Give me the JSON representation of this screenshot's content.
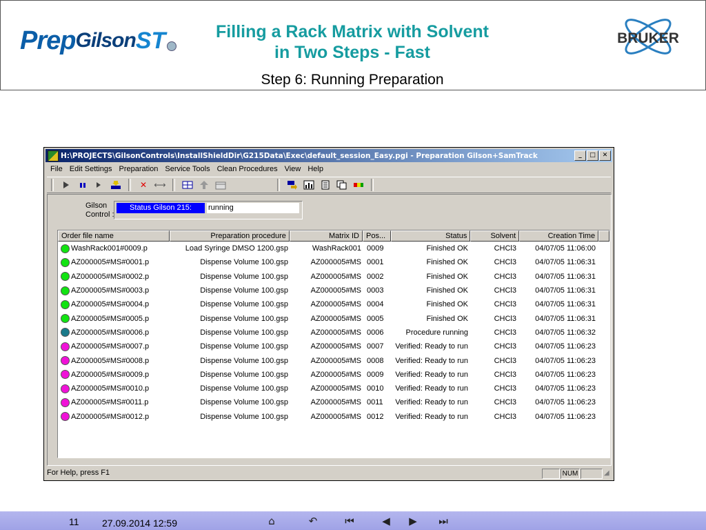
{
  "slide": {
    "logo_text": {
      "prep": "Prep",
      "gilson": "Gilson",
      "st": "ST"
    },
    "title_line1": "Filling a Rack Matrix with Solvent",
    "title_line2": "in Two Steps - Fast",
    "subtitle": "Step 6: Running Preparation",
    "brand": "BRUKER",
    "page_number": "11",
    "datetime": "27.09.2014 12:59"
  },
  "window": {
    "title": "H:\\PROJECTS\\GilsonControls\\InstallShieldDir\\G215Data\\Exec\\default_session_Easy.pgi - Preparation Gilson+SamTrack",
    "menu": [
      "File",
      "Edit Settings",
      "Preparation",
      "Service Tools",
      "Clean Procedures",
      "View",
      "Help"
    ],
    "gilson_control_label_line1": "Gilson",
    "gilson_control_label_line2": "Control :",
    "status_label": "Status Gilson 215:",
    "status_value": "running",
    "status_help": "For Help, press F1",
    "status_num": "NUM"
  },
  "table": {
    "columns": [
      "Order file name",
      "Preparation procedure",
      "Matrix ID",
      "Pos...",
      "Status",
      "Solvent",
      "Creation Time"
    ],
    "rows": [
      {
        "state": "ok",
        "file": "WashRack001#0009.p",
        "procedure": "Load Syringe DMSO 1200.gsp",
        "matrix": "WashRack001",
        "pos": "0009",
        "status": "Finished OK",
        "solvent": "CHCl3",
        "time": "04/07/05 11:06:00"
      },
      {
        "state": "ok",
        "file": "AZ000005#MS#0001.p",
        "procedure": "Dispense Volume 100.gsp",
        "matrix": "AZ000005#MS",
        "pos": "0001",
        "status": "Finished OK",
        "solvent": "CHCl3",
        "time": "04/07/05 11:06:31"
      },
      {
        "state": "ok",
        "file": "AZ000005#MS#0002.p",
        "procedure": "Dispense Volume 100.gsp",
        "matrix": "AZ000005#MS",
        "pos": "0002",
        "status": "Finished OK",
        "solvent": "CHCl3",
        "time": "04/07/05 11:06:31"
      },
      {
        "state": "ok",
        "file": "AZ000005#MS#0003.p",
        "procedure": "Dispense Volume 100.gsp",
        "matrix": "AZ000005#MS",
        "pos": "0003",
        "status": "Finished OK",
        "solvent": "CHCl3",
        "time": "04/07/05 11:06:31"
      },
      {
        "state": "ok",
        "file": "AZ000005#MS#0004.p",
        "procedure": "Dispense Volume 100.gsp",
        "matrix": "AZ000005#MS",
        "pos": "0004",
        "status": "Finished OK",
        "solvent": "CHCl3",
        "time": "04/07/05 11:06:31"
      },
      {
        "state": "ok",
        "file": "AZ000005#MS#0005.p",
        "procedure": "Dispense Volume 100.gsp",
        "matrix": "AZ000005#MS",
        "pos": "0005",
        "status": "Finished OK",
        "solvent": "CHCl3",
        "time": "04/07/05 11:06:31"
      },
      {
        "state": "run",
        "file": "AZ000005#MS#0006.p",
        "procedure": "Dispense Volume 100.gsp",
        "matrix": "AZ000005#MS",
        "pos": "0006",
        "status": "Procedure running",
        "solvent": "CHCl3",
        "time": "04/07/05 11:06:32"
      },
      {
        "state": "ready",
        "file": "AZ000005#MS#0007.p",
        "procedure": "Dispense Volume 100.gsp",
        "matrix": "AZ000005#MS",
        "pos": "0007",
        "status": "Verified: Ready to run",
        "solvent": "CHCl3",
        "time": "04/07/05 11:06:23"
      },
      {
        "state": "ready",
        "file": "AZ000005#MS#0008.p",
        "procedure": "Dispense Volume 100.gsp",
        "matrix": "AZ000005#MS",
        "pos": "0008",
        "status": "Verified: Ready to run",
        "solvent": "CHCl3",
        "time": "04/07/05 11:06:23"
      },
      {
        "state": "ready",
        "file": "AZ000005#MS#0009.p",
        "procedure": "Dispense Volume 100.gsp",
        "matrix": "AZ000005#MS",
        "pos": "0009",
        "status": "Verified: Ready to run",
        "solvent": "CHCl3",
        "time": "04/07/05 11:06:23"
      },
      {
        "state": "ready",
        "file": "AZ000005#MS#0010.p",
        "procedure": "Dispense Volume 100.gsp",
        "matrix": "AZ000005#MS",
        "pos": "0010",
        "status": "Verified: Ready to run",
        "solvent": "CHCl3",
        "time": "04/07/05 11:06:23"
      },
      {
        "state": "ready",
        "file": "AZ000005#MS#0011.p",
        "procedure": "Dispense Volume 100.gsp",
        "matrix": "AZ000005#MS",
        "pos": "0011",
        "status": "Verified: Ready to run",
        "solvent": "CHCl3",
        "time": "04/07/05 11:06:23"
      },
      {
        "state": "ready",
        "file": "AZ000005#MS#0012.p",
        "procedure": "Dispense Volume 100.gsp",
        "matrix": "AZ000005#MS",
        "pos": "0012",
        "status": "Verified: Ready to run",
        "solvent": "CHCl3",
        "time": "04/07/05 11:06:23"
      }
    ]
  },
  "colors": {
    "ok": "#12e312",
    "run": "#1a7a8a",
    "ready": "#f012d8",
    "title": "#169ca0"
  }
}
